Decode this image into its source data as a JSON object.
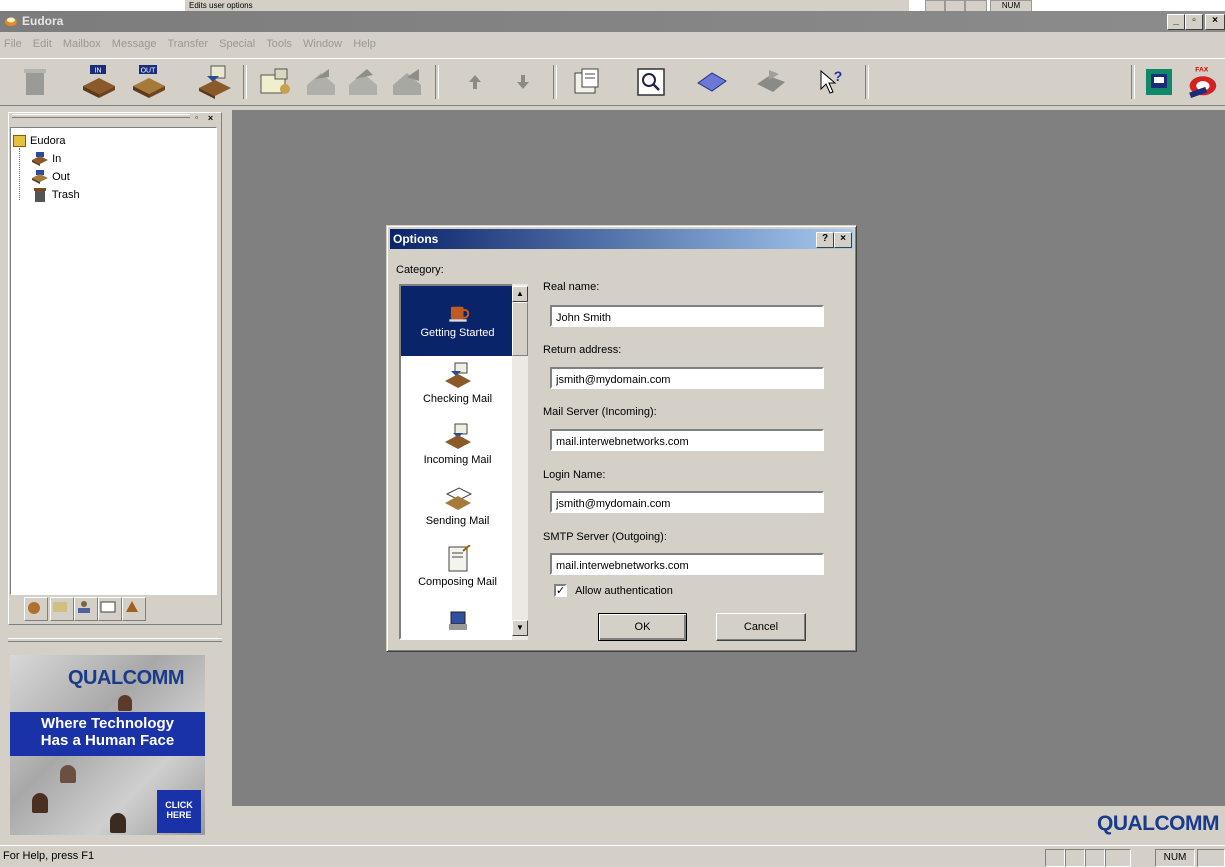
{
  "top_strip": {
    "tooltip": "Edits user options",
    "num": "NUM"
  },
  "window": {
    "title": "Eudora",
    "min": "_",
    "max": "▫",
    "close": "×"
  },
  "menu": [
    "File",
    "Edit",
    "Mailbox",
    "Message",
    "Transfer",
    "Special",
    "Tools",
    "Window",
    "Help"
  ],
  "toolbar": {
    "inbox_label": "IN",
    "outbox_label": "OUT",
    "fax_label": "FAX"
  },
  "tree": {
    "root": "Eudora",
    "items": [
      "In",
      "Out",
      "Trash"
    ]
  },
  "ad": {
    "brand": "QUALCOMM",
    "headline_1": "Where Technology",
    "headline_2": "Has a Human Face",
    "cta_1": "CLICK",
    "cta_2": "HERE"
  },
  "dialog": {
    "title": "Options",
    "help": "?",
    "close": "×",
    "category_label": "Category:",
    "categories": [
      "Getting Started",
      "Checking Mail",
      "Incoming Mail",
      "Sending Mail",
      "Composing Mail"
    ],
    "real_name_label": "Real name:",
    "real_name": "John Smith",
    "return_address_label": "Return address:",
    "return_address": "jsmith@mydomain.com",
    "mail_server_label": "Mail Server (Incoming):",
    "mail_server": "mail.interwebnetworks.com",
    "login_label": "Login Name:",
    "login": "jsmith@mydomain.com",
    "smtp_label": "SMTP Server (Outgoing):",
    "smtp": "mail.interwebnetworks.com",
    "allow_auth_label": "Allow authentication",
    "allow_auth": true,
    "ok": "OK",
    "cancel": "Cancel"
  },
  "brand_footer": "QUALCOMM",
  "status": {
    "help_text": "For Help, press F1",
    "num": "NUM"
  }
}
